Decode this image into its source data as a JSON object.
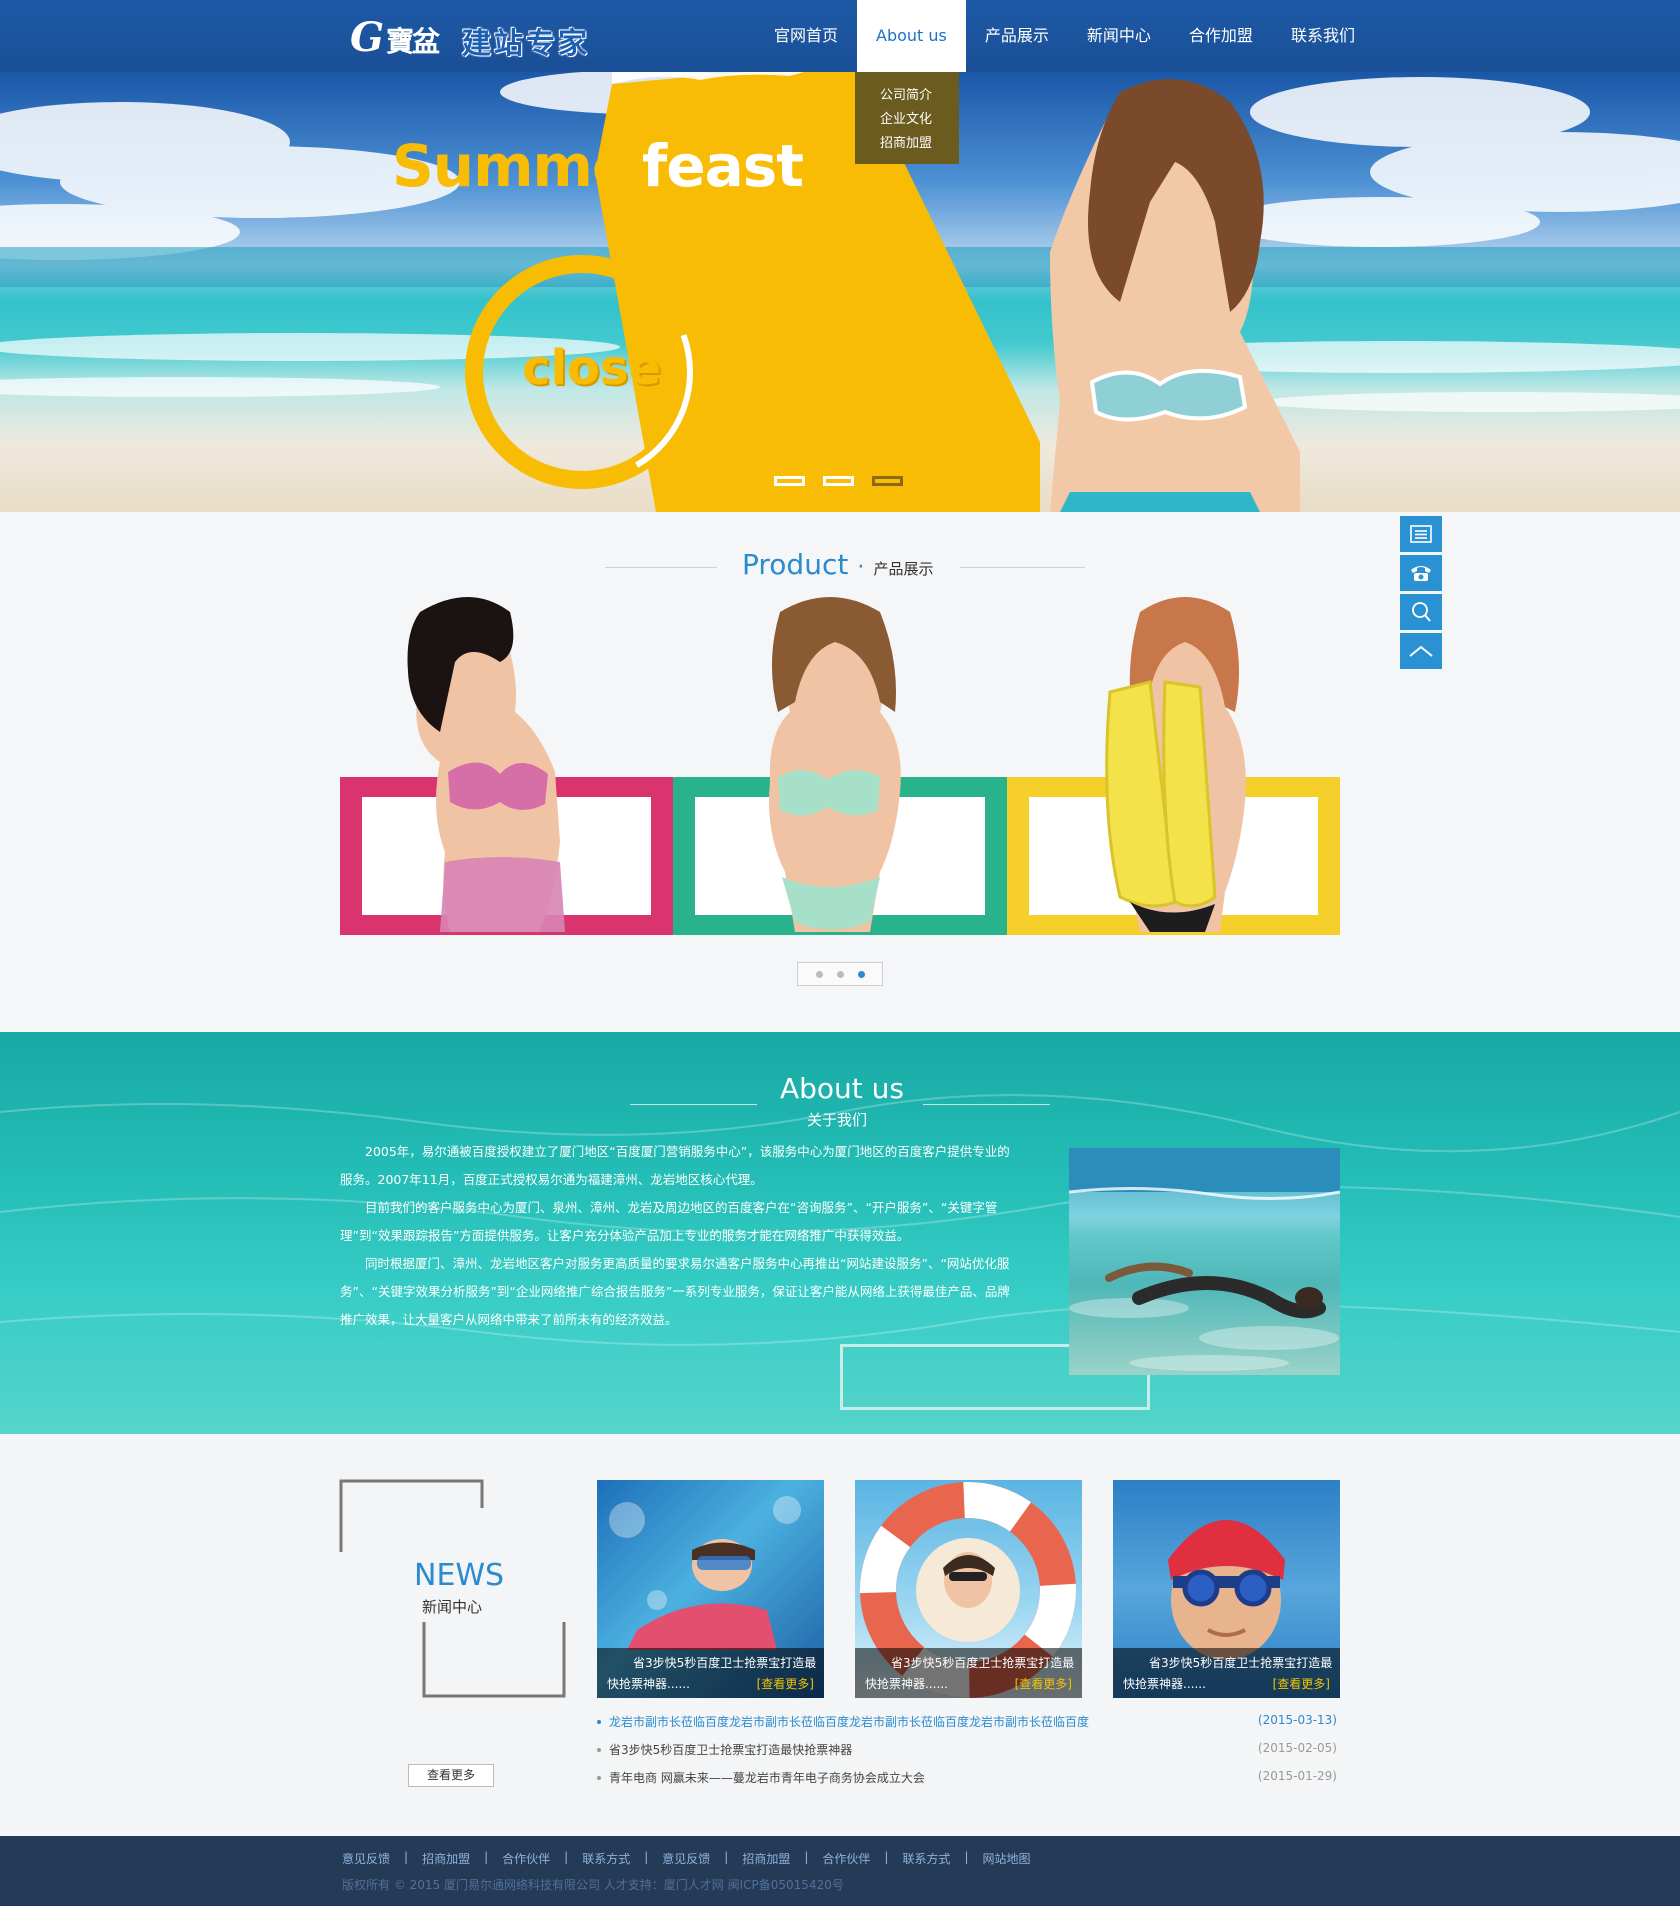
{
  "header": {
    "logo_letter": "G",
    "logo_text": "寶盆",
    "logo_slogan": "建站专家",
    "nav": [
      {
        "label": "官网首页"
      },
      {
        "label": "About us"
      },
      {
        "label": "产品展示"
      },
      {
        "label": "新闻中心"
      },
      {
        "label": "合作加盟"
      },
      {
        "label": "联系我们"
      }
    ],
    "dropdown": [
      "公司简介",
      "企业文化",
      "招商加盟"
    ]
  },
  "hero": {
    "title_a": "Summer",
    "title_b": "feast",
    "badge": "close",
    "slides": 3,
    "active_slide": 3,
    "colors": {
      "yellow": "#f9bc05"
    }
  },
  "product": {
    "title_en": "Product",
    "title_dot": "·",
    "title_cn": "产品展示",
    "frame_colors": [
      "#d9346d",
      "#28b38d",
      "#f7cf2b"
    ],
    "pages": 3,
    "active_page": 3
  },
  "about": {
    "title_en": "About us",
    "title_cn": "关于我们",
    "paragraphs": [
      "2005年，易尔通被百度授权建立了厦门地区“百度厦门营销服务中心”，该服务中心为厦门地区的百度客户提供专业的服务。2007年11月，百度正式授权易尔通为福建漳州、龙岩地区核心代理。",
      "目前我们的客户服务中心为厦门、泉州、漳州、龙岩及周边地区的百度客户在“咨询服务”、“开户服务”、“关键字管理”到“效果跟踪报告”方面提供服务。让客户充分体验产品加上专业的服务才能在网络推广中获得效益。",
      "同时根据厦门、漳州、龙岩地区客户对服务更高质量的要求易尔通客户服务中心再推出“网站建设服务”、“网站优化服务”、“关键字效果分析服务”到“企业网络推广综合报告服务”一系列专业服务，保证让客户能从网络上获得最佳产品、品牌推广效果，让大量客户从网络中带来了前所未有的经济效益。"
    ]
  },
  "news": {
    "title_en": "NEWS",
    "title_cn": "新闻中心",
    "more_button": "查看更多",
    "cards": [
      {
        "line1": "省3步快5秒百度卫士抢票宝打造最",
        "line2": "快抢票神器......",
        "more": "[查看更多]"
      },
      {
        "line1": "省3步快5秒百度卫士抢票宝打造最",
        "line2": "快抢票神器......",
        "more": "[查看更多]"
      },
      {
        "line1": "省3步快5秒百度卫士抢票宝打造最",
        "line2": "快抢票神器......",
        "more": "[查看更多]"
      }
    ],
    "list": [
      {
        "title": "龙岩市副市长莅临百度龙岩市副市长莅临百度龙岩市副市长莅临百度龙岩市副市长莅临百度",
        "date": "(2015-03-13)",
        "highlight": true
      },
      {
        "title": "省3步快5秒百度卫士抢票宝打造最快抢票神器",
        "date": "(2015-02-05)",
        "highlight": false
      },
      {
        "title": "青年电商 网赢未来——蔓龙岩市青年电子商务协会成立大会",
        "date": "(2015-01-29)",
        "highlight": false
      }
    ]
  },
  "footer": {
    "links": [
      "意见反馈",
      "招商加盟",
      "合作伙伴",
      "联系方式",
      "意见反馈",
      "招商加盟",
      "合作伙伴",
      "联系方式",
      "网站地图"
    ],
    "separator": "|",
    "copyright": "版权所有 © 2015 厦门易尔通网络科技有限公司 人才支持：厦门人才网 闽ICP备05015420号"
  },
  "side_tools": [
    {
      "icon": "list-icon"
    },
    {
      "icon": "phone-icon"
    },
    {
      "icon": "search-icon"
    },
    {
      "icon": "back-to-top-icon"
    }
  ],
  "colors": {
    "brand_blue": "#1d59a6",
    "accent_blue": "#2a92d2",
    "teal": "#23bdb6",
    "footer": "#243a56"
  }
}
